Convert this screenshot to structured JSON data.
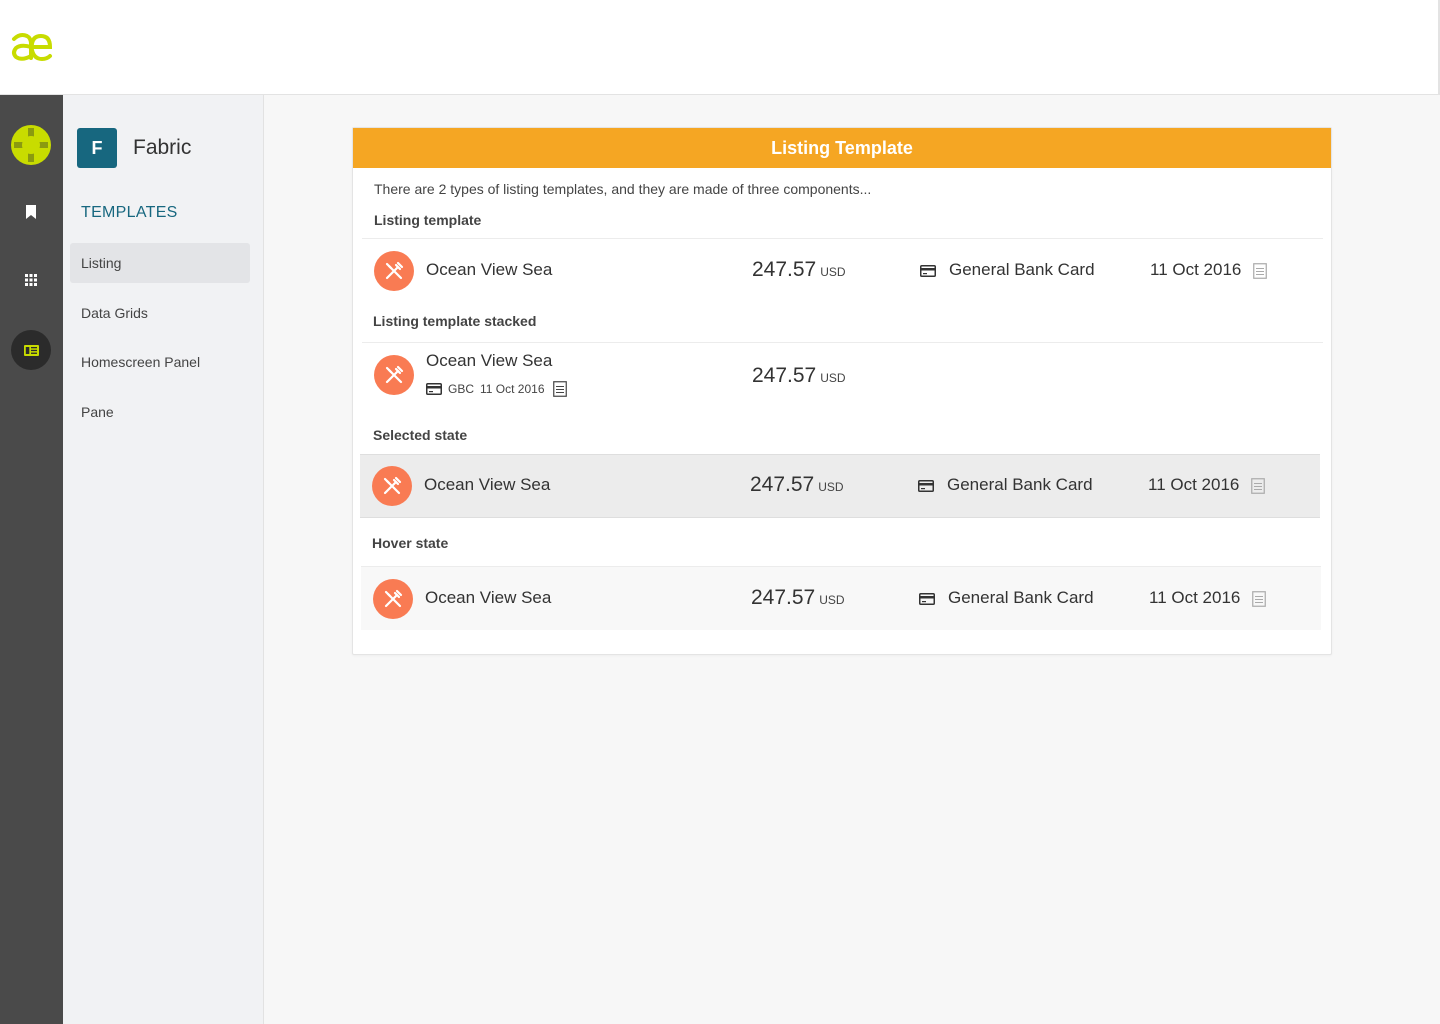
{
  "app": {
    "logo_icon": "ae-logo"
  },
  "rail": {
    "items": [
      {
        "icon": "user-avatar-icon"
      },
      {
        "icon": "bookmark-icon"
      },
      {
        "icon": "grid-icon"
      },
      {
        "icon": "panel-icon",
        "active": true
      }
    ]
  },
  "subnav": {
    "brand_letter": "F",
    "brand_name": "Fabric",
    "section_title": "TEMPLATES",
    "items": [
      {
        "label": "Listing",
        "active": true
      },
      {
        "label": "Data Grids"
      },
      {
        "label": "Homescreen Panel"
      },
      {
        "label": "Pane"
      }
    ]
  },
  "card": {
    "title": "Listing Template",
    "intro": "There are 2 types of listing templates, and they are made of three components...",
    "sections": [
      {
        "label": "Listing template"
      },
      {
        "label": "Listing template stacked"
      },
      {
        "label": "Selected state"
      },
      {
        "label": "Hover state"
      }
    ],
    "row": {
      "icon": "cutlery-icon",
      "name": "Ocean View Sea",
      "amount": "247.57",
      "currency": "USD",
      "method_icon": "credit-card-icon",
      "method": "General Bank Card",
      "method_short": "GBC",
      "date": "11 Oct 2016",
      "doc_icon": "document-icon"
    }
  },
  "colors": {
    "accent": "#f5a623",
    "brand": "#17677f",
    "avatar": "#f97b53",
    "logo": "#c8dc00",
    "rail": "#4a4a4a"
  }
}
